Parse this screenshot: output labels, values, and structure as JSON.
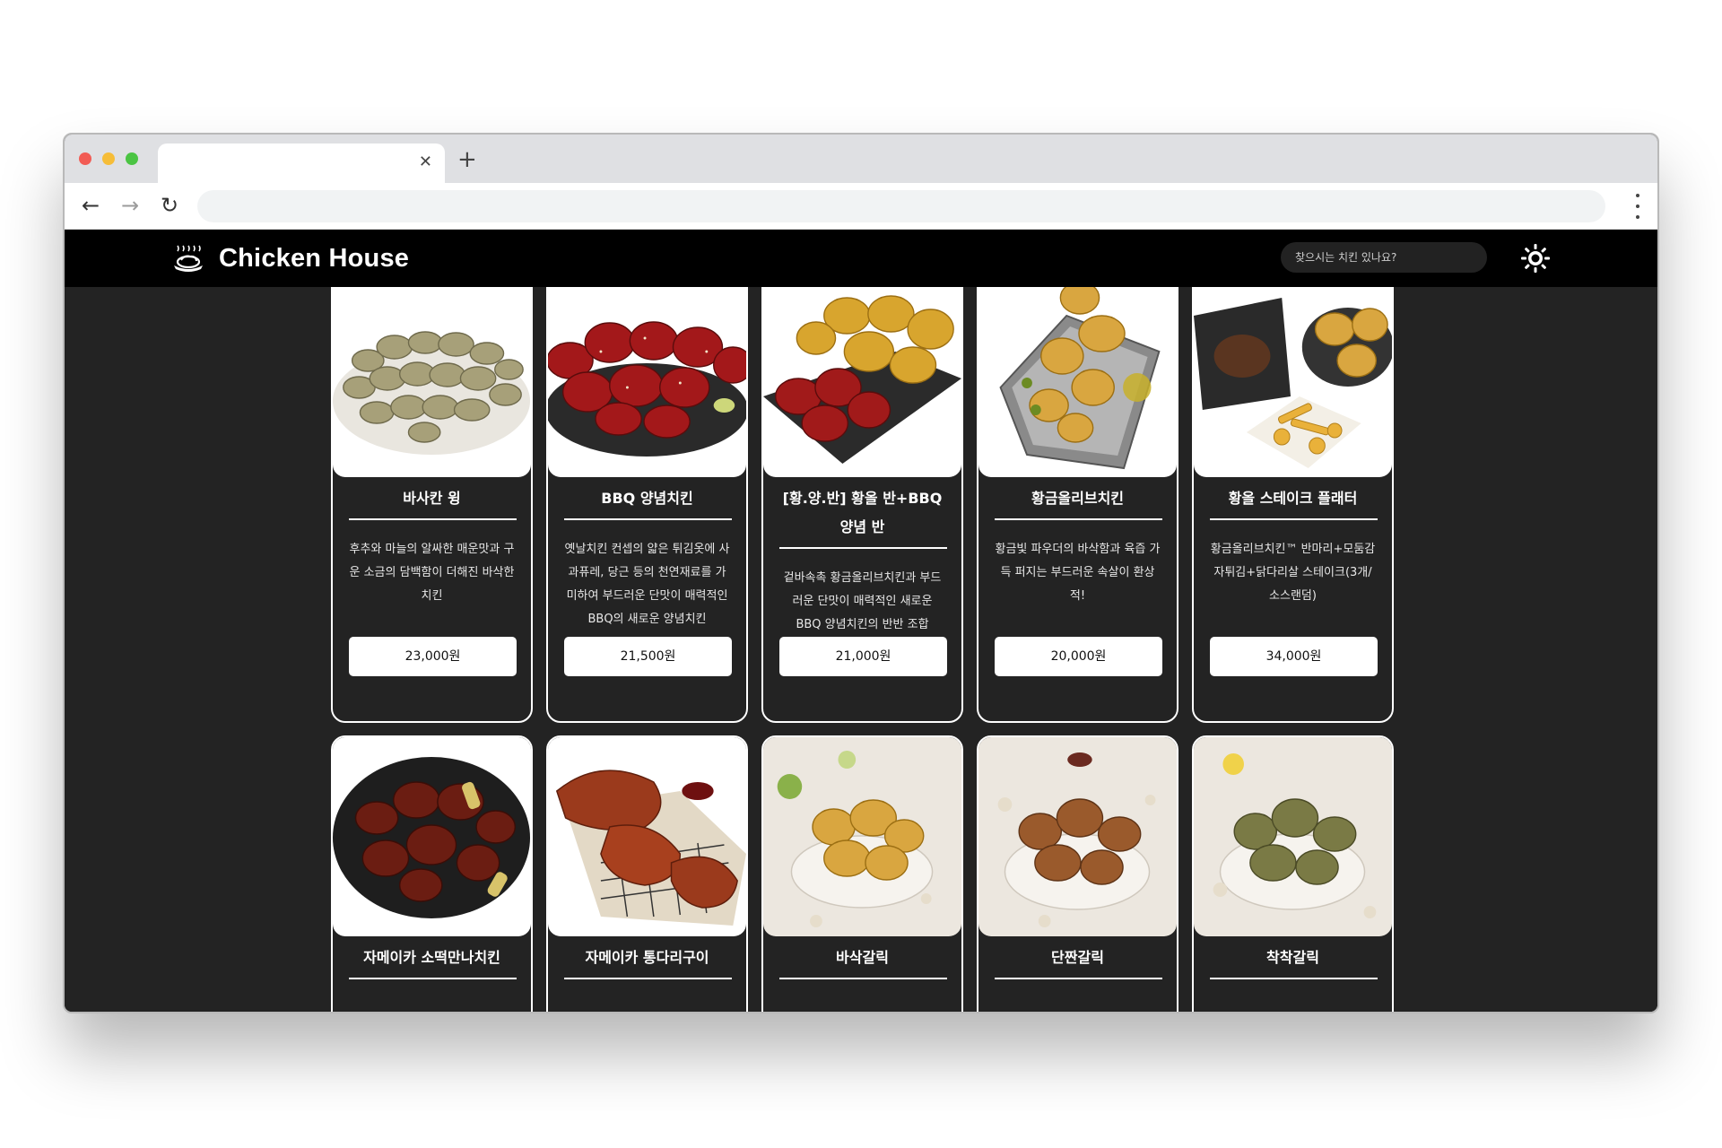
{
  "site": {
    "title": "Chicken House",
    "search_placeholder": "찾으시는 치킨 있나요?",
    "logo_icon": "chicken-dish-icon",
    "theme_icon": "sun-icon"
  },
  "colors": {
    "header_bg": "#000000",
    "page_bg": "#232323",
    "card_border": "#ffffff",
    "button_bg": "#ffffff"
  },
  "menu": [
    {
      "name": "바사칸 윙",
      "desc": "후추와 마늘의 알싸한 매운맛과 구운 소금의 담백함이 더해진 바삭한 치킨",
      "price": "23,000원"
    },
    {
      "name": "BBQ 양념치킨",
      "desc": "옛날치킨 컨셉의 얇은 튀김옷에 사과퓨레, 당근 등의 천연재료를 가미하여 부드러운 단맛이 매력적인 BBQ의 새로운 양념치킨",
      "price": "21,500원"
    },
    {
      "name": "[황.양.반] 황올 반+BBQ 양념 반",
      "desc": "겉바속촉 황금올리브치킨과 부드러운 단맛이 매력적인 새로운 BBQ 양념치킨의 반반 조합",
      "price": "21,000원"
    },
    {
      "name": "황금올리브치킨",
      "desc": "황금빛 파우더의 바삭함과 육즙 가득 퍼지는 부드러운 속살이 환상적!",
      "price": "20,000원"
    },
    {
      "name": "황올 스테이크 플래터",
      "desc": "황금올리브치킨™ 반마리+모둠감자튀김+닭다리살 스테이크(3개/소스랜덤)",
      "price": "34,000원"
    },
    {
      "name": "자메이카 소떡만나치킨"
    },
    {
      "name": "자메이카 통다리구이"
    },
    {
      "name": "바삭갈릭"
    },
    {
      "name": "단짠갈릭"
    },
    {
      "name": "착착갈릭"
    }
  ]
}
